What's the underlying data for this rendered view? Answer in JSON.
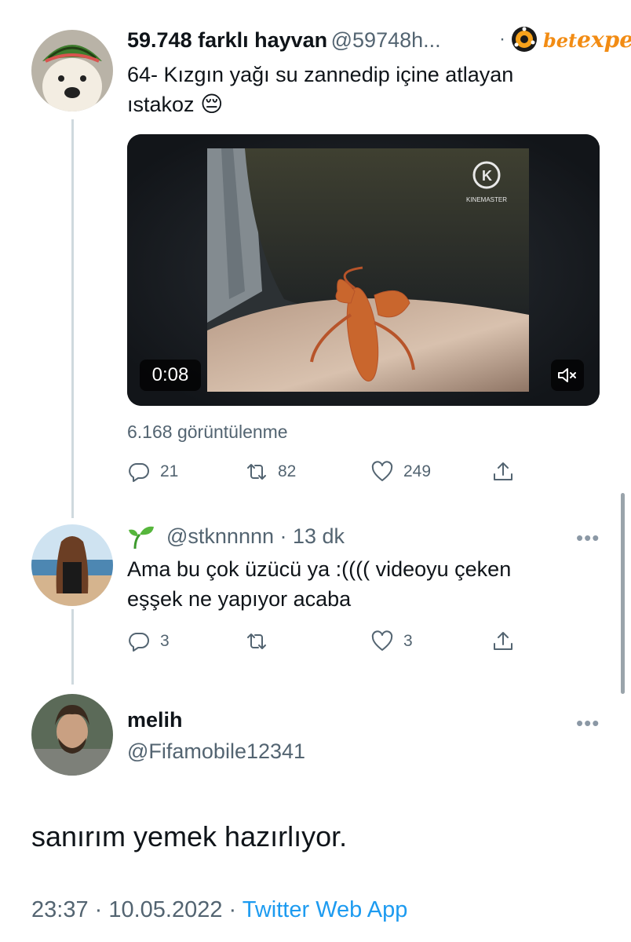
{
  "main_tweet": {
    "name": "59.748 farklı hayvan",
    "handle": "@59748h...",
    "text_line1": "64- Kızgın yağı su zannedip içine atlayan",
    "text_line2": "ıstakoz",
    "emoji": "😔",
    "watermark": "betexper",
    "video": {
      "duration": "0:08",
      "watermark_text": "KINEMASTER"
    },
    "views": "6.168 görüntülenme",
    "replies": "21",
    "retweets": "82",
    "likes": "249"
  },
  "reply": {
    "handle_time": "@stknnnnn · 13 dk",
    "text_line1": "Ama bu çok üzücü ya :(((( videoyu çeken",
    "text_line2": "eşşek ne yapıyor acaba",
    "replies": "3",
    "retweets": "",
    "likes": "3"
  },
  "focused_tweet": {
    "name": "melih",
    "handle": "@Fifamobile12341",
    "text": "sanırım yemek hazırlıyor.",
    "timestamp": "23:37 · 10.05.2022",
    "separator": " · ",
    "source": "Twitter Web App"
  },
  "icons": {
    "reply": "reply-icon",
    "retweet": "retweet-icon",
    "like": "heart-icon",
    "share": "share-icon",
    "more": "more-icon",
    "mute": "mute-icon",
    "sprout": "sprout-icon"
  },
  "colors": {
    "link": "#1d9bf0",
    "secondary_text": "#536471",
    "thread_line": "#cfd9de"
  }
}
